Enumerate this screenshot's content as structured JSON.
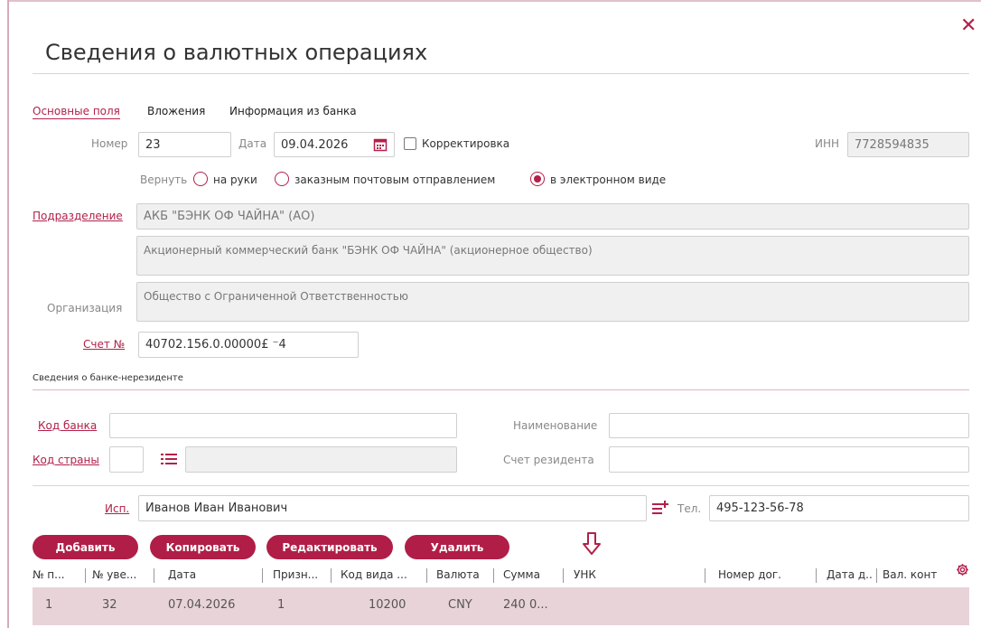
{
  "dialog": {
    "title": "Сведения о валютных операциях",
    "close_glyph": "✕"
  },
  "tabs": [
    {
      "label": "Основные поля",
      "active": true
    },
    {
      "label": "Вложения",
      "active": false
    },
    {
      "label": "Информация из банка",
      "active": false
    }
  ],
  "form": {
    "number_label": "Номер",
    "number_value": "23",
    "date_label": "Дата",
    "date_value": "09.04.2026",
    "correction_label": "Корректировка",
    "inn_label": "ИНН",
    "inn_value": "7728594835",
    "return_label": "Вернуть",
    "return_options": [
      {
        "label": "на руки",
        "selected": false
      },
      {
        "label": "заказным почтовым отправлением",
        "selected": false
      },
      {
        "label": "в электронном виде",
        "selected": true
      }
    ],
    "division_label": "Подразделение",
    "division_value": "АКБ \"БЭНК ОФ ЧАЙНА\" (АО)",
    "division_full": "Акционерный коммерческий банк \"БЭНК ОФ ЧАЙНА\" (акционерное общество)",
    "org_label": "Организация",
    "org_value": "Общество с Ограниченной Ответственностью",
    "account_label": "Счет №",
    "account_value": "40702.156.0.00000£       ⁻4"
  },
  "nonresident": {
    "section_title": "Сведения о банке-нерезиденте",
    "bank_code_label": "Код банка",
    "bank_code_value": "",
    "name_label": "Наименование",
    "name_value": "",
    "country_code_label": "Код страны",
    "country_code_value": "",
    "country_name_value": "",
    "resident_account_label": "Счет резидента",
    "resident_account_value": ""
  },
  "executor": {
    "label": "Исп.",
    "value": "Иванов Иван Иванович",
    "phone_label": "Тел.",
    "phone_value": "495-123-56-78"
  },
  "buttons": {
    "add": "Добавить",
    "copy": "Копировать",
    "edit": "Редактировать",
    "delete": "Удалить"
  },
  "table": {
    "columns": [
      "№ п...",
      "№ уве...",
      "Дата",
      "Призн...",
      "Код вида ...",
      "Валюта",
      "Сумма",
      "УНК",
      "Номер дог.",
      "Дата д...",
      "Вал. конт"
    ],
    "rows": [
      [
        "1",
        "32",
        "07.04.2026",
        "1",
        "10200",
        "CNY",
        "240 0...",
        "",
        "",
        "",
        ""
      ]
    ]
  },
  "colors": {
    "accent": "#b01e48",
    "row_highlight": "#e8d3d8",
    "readonly_bg": "#f0f0f0"
  }
}
